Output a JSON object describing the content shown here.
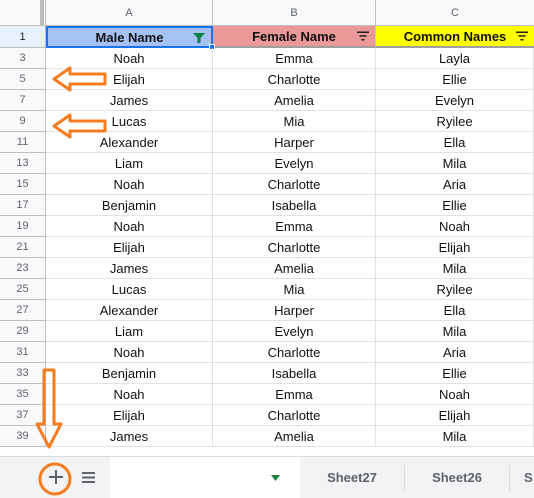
{
  "columns": [
    "A",
    "B",
    "C"
  ],
  "headers": {
    "row_num": "1",
    "a": "Male Name",
    "b": "Female Name",
    "c": "Common Names"
  },
  "rows": [
    {
      "num": "3",
      "a": "Noah",
      "b": "Emma",
      "c": "Layla"
    },
    {
      "num": "5",
      "a": "Elijah",
      "b": "Charlotte",
      "c": "Ellie"
    },
    {
      "num": "7",
      "a": "James",
      "b": "Amelia",
      "c": "Evelyn"
    },
    {
      "num": "9",
      "a": "Lucas",
      "b": "Mia",
      "c": "Ryilee"
    },
    {
      "num": "11",
      "a": "Alexander",
      "b": "Harper",
      "c": "Ella"
    },
    {
      "num": "13",
      "a": "Liam",
      "b": "Evelyn",
      "c": "Mila"
    },
    {
      "num": "15",
      "a": "Noah",
      "b": "Charlotte",
      "c": "Aria"
    },
    {
      "num": "17",
      "a": "Benjamin",
      "b": "Isabella",
      "c": "Ellie"
    },
    {
      "num": "19",
      "a": "Noah",
      "b": "Emma",
      "c": "Noah"
    },
    {
      "num": "21",
      "a": "Elijah",
      "b": "Charlotte",
      "c": "Elijah"
    },
    {
      "num": "23",
      "a": "James",
      "b": "Amelia",
      "c": "Mila"
    },
    {
      "num": "25",
      "a": "Lucas",
      "b": "Mia",
      "c": "Ryilee"
    },
    {
      "num": "27",
      "a": "Alexander",
      "b": "Harper",
      "c": "Ella"
    },
    {
      "num": "29",
      "a": "Liam",
      "b": "Evelyn",
      "c": "Mila"
    },
    {
      "num": "31",
      "a": "Noah",
      "b": "Charlotte",
      "c": "Aria"
    },
    {
      "num": "33",
      "a": "Benjamin",
      "b": "Isabella",
      "c": "Ellie"
    },
    {
      "num": "35",
      "a": "Noah",
      "b": "Emma",
      "c": "Noah"
    },
    {
      "num": "37",
      "a": "Elijah",
      "b": "Charlotte",
      "c": "Elijah"
    },
    {
      "num": "39",
      "a": "James",
      "b": "Amelia",
      "c": "Mila"
    }
  ],
  "tabbar": {
    "add_icon": "plus-icon",
    "list_icon": "list-icon",
    "tabs": [
      "Sheet27",
      "Sheet26",
      "S"
    ]
  },
  "colors": {
    "male_header": "#a4c2f4",
    "female_header": "#ea9999",
    "common_header": "#ffff00",
    "filter_active": "#0b8043",
    "annotation": "#f57c1f"
  }
}
